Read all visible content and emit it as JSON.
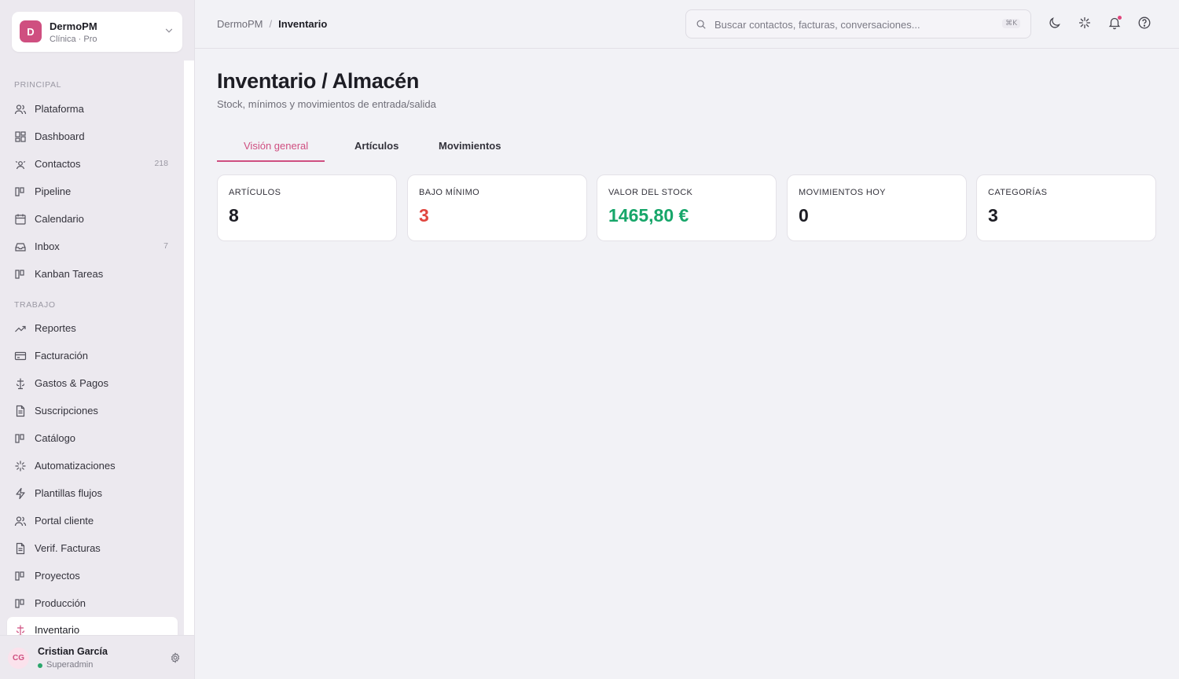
{
  "org": {
    "logo_letter": "D",
    "name": "DermoPM",
    "plan": "Clínica · Pro"
  },
  "sidebar": {
    "sections": [
      {
        "label": "Principal"
      },
      {
        "label": "Trabajo"
      }
    ],
    "items": [
      {
        "label": "Plataforma",
        "icon": "users-icon"
      },
      {
        "label": "Dashboard",
        "icon": "dashboard-icon"
      },
      {
        "label": "Contactos",
        "icon": "contacts-icon",
        "badge": "218"
      },
      {
        "label": "Pipeline",
        "icon": "columns-icon"
      },
      {
        "label": "Calendario",
        "icon": "calendar-icon"
      },
      {
        "label": "Inbox",
        "icon": "inbox-icon",
        "badge": "7"
      },
      {
        "label": "Kanban Tareas",
        "icon": "columns-icon"
      },
      {
        "label": "Reportes",
        "icon": "trending-up-icon"
      },
      {
        "label": "Facturación",
        "icon": "credit-card-icon"
      },
      {
        "label": "Gastos & Pagos",
        "icon": "scale-icon"
      },
      {
        "label": "Suscripciones",
        "icon": "document-icon"
      },
      {
        "label": "Catálogo",
        "icon": "columns-icon"
      },
      {
        "label": "Automatizaciones",
        "icon": "sparkle-icon"
      },
      {
        "label": "Plantillas flujos",
        "icon": "bolt-icon"
      },
      {
        "label": "Portal cliente",
        "icon": "users-icon"
      },
      {
        "label": "Verif. Facturas",
        "icon": "document-icon"
      },
      {
        "label": "Proyectos",
        "icon": "columns-icon"
      },
      {
        "label": "Producción",
        "icon": "columns-icon"
      },
      {
        "label": "Inventario",
        "icon": "scale-icon",
        "active": true
      }
    ]
  },
  "user": {
    "initials": "CG",
    "name": "Cristian García",
    "role": "Superadmin"
  },
  "header": {
    "breadcrumb": [
      "DermoPM",
      "Inventario"
    ],
    "search_placeholder": "Buscar contactos, facturas, conversaciones...",
    "search_shortcut": "⌘K"
  },
  "page": {
    "title": "Inventario / Almacén",
    "subtitle": "Stock, mínimos y movimientos de entrada/salida"
  },
  "tabs": [
    {
      "label": "Visión general",
      "active": true
    },
    {
      "label": "Artículos"
    },
    {
      "label": "Movimientos"
    }
  ],
  "stats": [
    {
      "label": "Artículos",
      "value": "8"
    },
    {
      "label": "Bajo mínimo",
      "value": "3"
    },
    {
      "label": "Valor del stock",
      "value": "1465,80 €"
    },
    {
      "label": "Movimientos hoy",
      "value": "0"
    },
    {
      "label": "Categorías",
      "value": "3"
    }
  ],
  "colors": {
    "accent": "#cf4f80",
    "danger": "#e0463f",
    "success": "#17a66a"
  }
}
